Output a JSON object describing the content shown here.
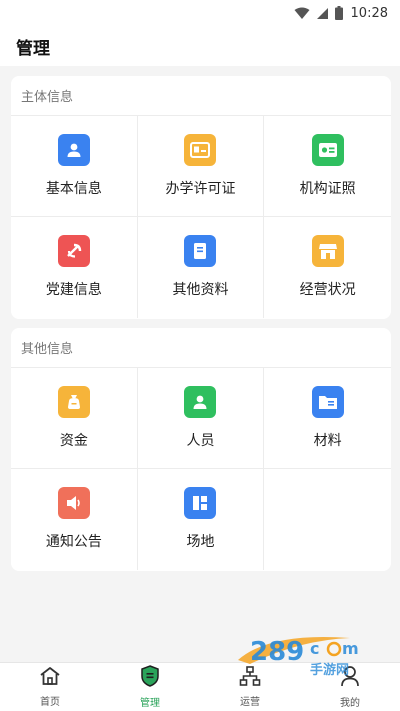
{
  "status_bar": {
    "time": "10:28"
  },
  "header": {
    "title": "管理"
  },
  "sections": [
    {
      "title": "主体信息",
      "items": [
        {
          "label": "基本信息",
          "icon": "person-card-icon",
          "color": "#3a82f0"
        },
        {
          "label": "办学许可证",
          "icon": "license-card-icon",
          "color": "#f6b43a"
        },
        {
          "label": "机构证照",
          "icon": "id-card-icon",
          "color": "#2fbf5f"
        },
        {
          "label": "党建信息",
          "icon": "party-emblem-icon",
          "color": "#ee5454"
        },
        {
          "label": "其他资料",
          "icon": "document-icon",
          "color": "#3a82f0"
        },
        {
          "label": "经营状况",
          "icon": "store-icon",
          "color": "#f6b43a"
        }
      ]
    },
    {
      "title": "其他信息",
      "items": [
        {
          "label": "资金",
          "icon": "money-bag-icon",
          "color": "#f6b43a"
        },
        {
          "label": "人员",
          "icon": "person-icon",
          "color": "#2fbf5f"
        },
        {
          "label": "材料",
          "icon": "folder-icon",
          "color": "#3a82f0"
        },
        {
          "label": "通知公告",
          "icon": "speaker-icon",
          "color": "#f0705a"
        },
        {
          "label": "场地",
          "icon": "layout-icon",
          "color": "#3a82f0"
        }
      ]
    }
  ],
  "tabs": [
    {
      "label": "首页",
      "icon": "home-icon"
    },
    {
      "label": "管理",
      "icon": "manage-shield-icon",
      "active": true
    },
    {
      "label": "运营",
      "icon": "hierarchy-icon"
    },
    {
      "label": "我的",
      "icon": "user-icon"
    }
  ],
  "colors": {
    "accent": "#2aa35a"
  }
}
